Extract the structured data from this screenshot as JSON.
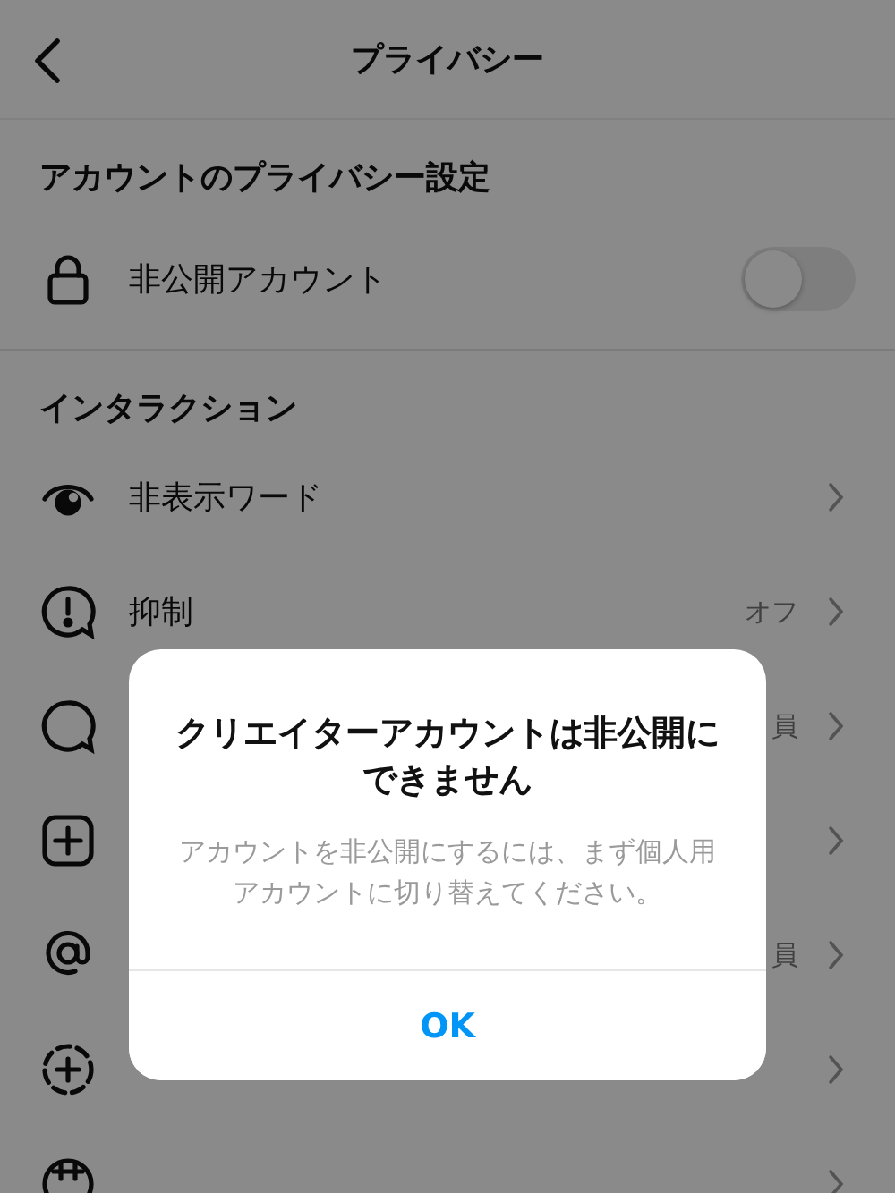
{
  "header": {
    "title": "プライバシー"
  },
  "sections": [
    {
      "title": "アカウントのプライバシー設定",
      "items": [
        {
          "kind": "toggle",
          "label": "非公開アカウント",
          "on": false
        }
      ]
    },
    {
      "title": "インタラクション",
      "items": [
        {
          "kind": "link",
          "label": "非表示ワード"
        },
        {
          "kind": "link",
          "label": "抑制",
          "value": "オフ"
        },
        {
          "kind": "link",
          "value": "員"
        },
        {
          "kind": "link"
        },
        {
          "kind": "link",
          "value": "員"
        },
        {
          "kind": "link"
        },
        {
          "kind": "link"
        }
      ]
    }
  ],
  "dialog": {
    "title": "クリエイターアカウントは非公開にできません",
    "message": "アカウントを非公開にするには、まず個人用アカウントに切り替えてください。",
    "button": "OK"
  }
}
